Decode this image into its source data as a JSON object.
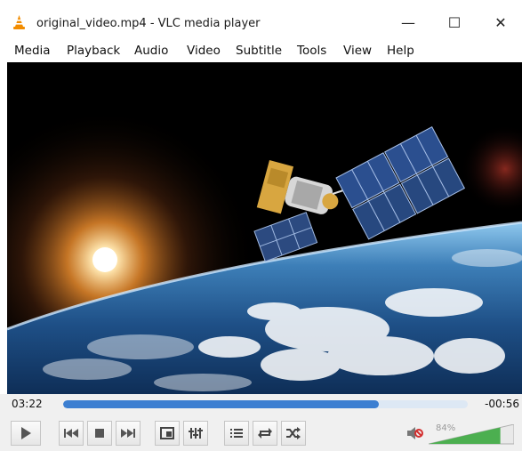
{
  "window": {
    "title": "original_video.mp4 - VLC media player",
    "minimize_glyph": "—",
    "maximize_glyph": "☐",
    "close_glyph": "✕"
  },
  "menu": {
    "items": [
      {
        "label": "Media"
      },
      {
        "label": "Playback"
      },
      {
        "label": "Audio"
      },
      {
        "label": "Video"
      },
      {
        "label": "Subtitle"
      },
      {
        "label": "Tools"
      },
      {
        "label": "View"
      },
      {
        "label": "Help"
      }
    ]
  },
  "video": {
    "scene": "satellite orbiting above Earth with sunrise"
  },
  "playback": {
    "elapsed": "03:22",
    "remaining": "-00:56",
    "progress_fraction": 0.78
  },
  "controls": {
    "buttons": [
      {
        "name": "play-button",
        "icon": "play-icon"
      },
      {
        "name": "previous-button",
        "icon": "skip-previous-icon"
      },
      {
        "name": "stop-button",
        "icon": "stop-icon"
      },
      {
        "name": "next-button",
        "icon": "skip-next-icon"
      },
      {
        "name": "fullscreen-button",
        "icon": "fullscreen-icon"
      },
      {
        "name": "extended-settings-button",
        "icon": "equalizer-icon"
      },
      {
        "name": "playlist-button",
        "icon": "playlist-icon"
      },
      {
        "name": "loop-button",
        "icon": "loop-icon"
      },
      {
        "name": "shuffle-button",
        "icon": "shuffle-icon"
      }
    ]
  },
  "volume": {
    "percent_label": "84%",
    "level": 0.84,
    "muted": true
  },
  "colors": {
    "seek_fill": "#3c7fd1",
    "volume_fill": "#4caf50",
    "mute_red": "#d32f2f",
    "vlc_orange": "#f28c00"
  }
}
